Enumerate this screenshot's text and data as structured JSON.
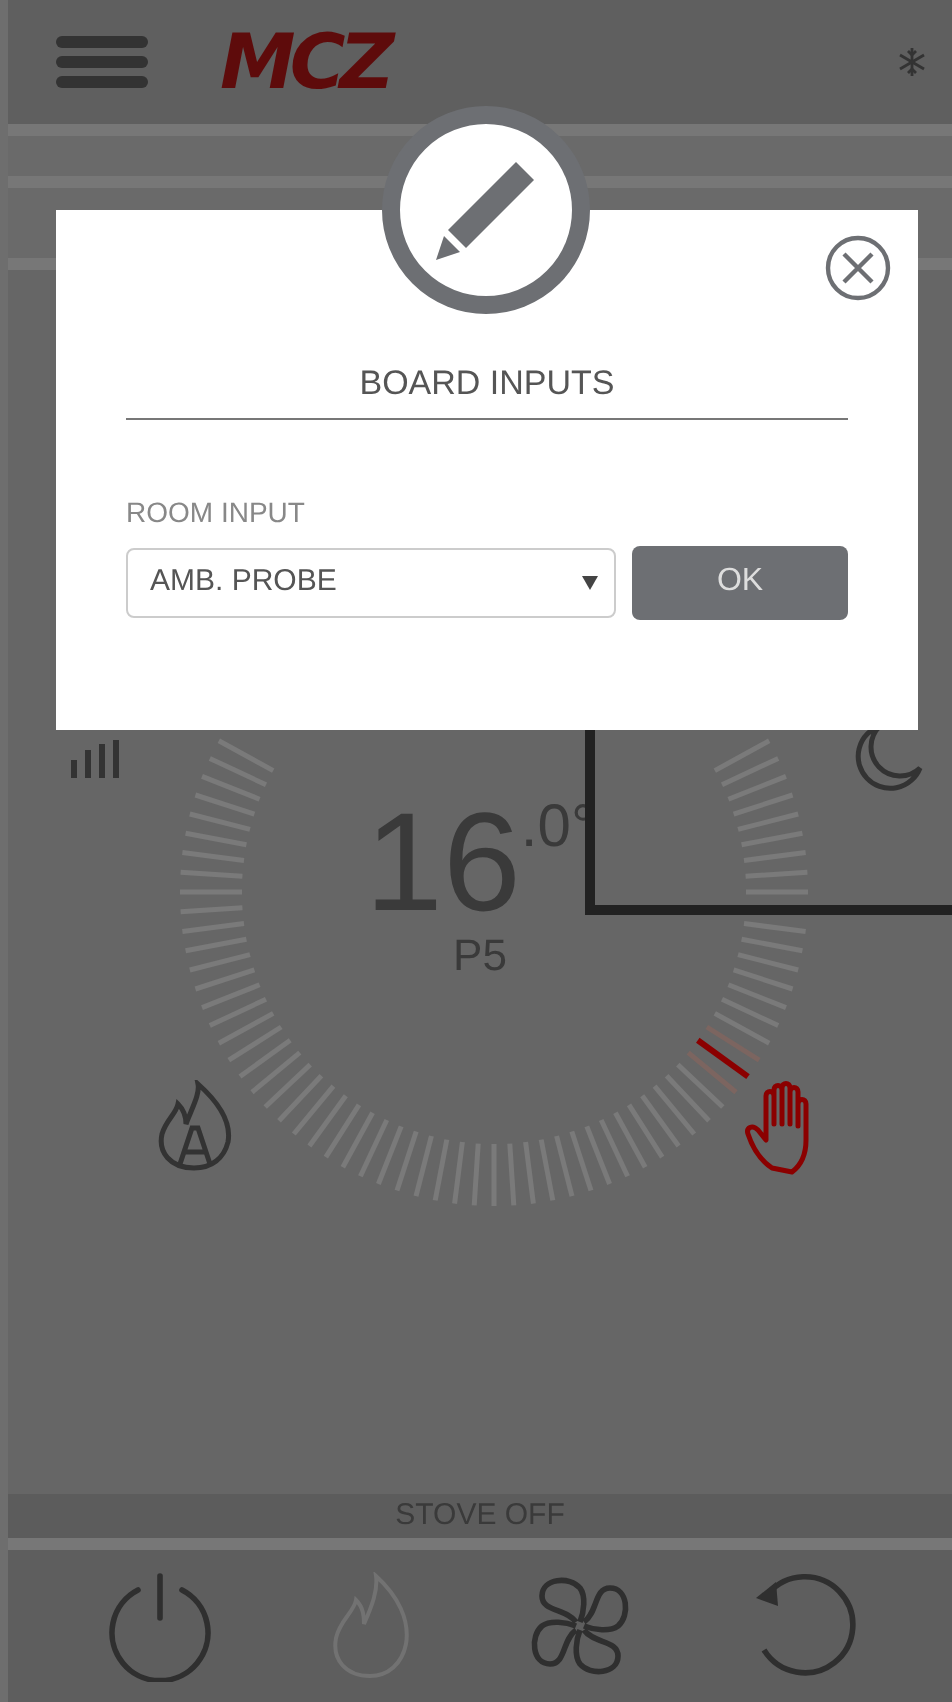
{
  "header": {
    "logo": "MCZ"
  },
  "dial": {
    "temperature": "16",
    "decimal": ".0°",
    "power": "P5"
  },
  "modes": [
    {
      "kind": "auto-flame",
      "selected": false
    },
    {
      "kind": "manual",
      "selected": true
    }
  ],
  "status_bar": "STOVE OFF",
  "bottom_bar": [
    {
      "kind": "power",
      "disabled": false
    },
    {
      "kind": "flame",
      "disabled": true
    },
    {
      "kind": "fan",
      "disabled": false
    },
    {
      "kind": "reset",
      "disabled": false
    }
  ],
  "modal": {
    "title": "BOARD INPUTS",
    "field_label": "ROOM INPUT",
    "select_value": "AMB. PROBE",
    "button": "OK"
  }
}
